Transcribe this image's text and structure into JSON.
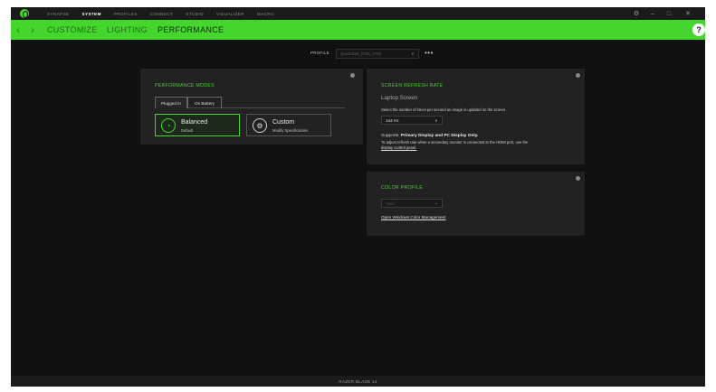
{
  "nav": {
    "items": [
      "SYNAPSE",
      "SYSTEM",
      "PROFILES",
      "CONNECT",
      "STUDIO",
      "VISUALIZER",
      "MACRO"
    ],
    "active": "SYSTEM"
  },
  "window_controls": {
    "settings": "⚙",
    "minimize": "–",
    "maximize": "□",
    "close": "✕"
  },
  "subnav": {
    "back": "‹",
    "forward": "›",
    "customize": "CUSTOMIZE",
    "lighting": "LIGHTING",
    "performance": "PERFORMANCE",
    "help": "?"
  },
  "profile": {
    "label": "PROFILE",
    "value": "QuickStart_0705_1708",
    "more": "•••"
  },
  "performance_modes": {
    "title": "PERFORMANCE MODES",
    "tabs": [
      "Plugged In",
      "On Battery"
    ],
    "active_tab": "Plugged In",
    "modes": [
      {
        "name": "Balanced",
        "sub": "Default",
        "selected": true
      },
      {
        "name": "Custom",
        "sub": "Modify Specifications",
        "selected": false
      }
    ]
  },
  "refresh_rate": {
    "title": "SCREEN REFRESH RATE",
    "subtitle": "Laptop Screen",
    "description": "Select the number of times per second an image is updated on the screen.",
    "value": "144 Hz",
    "supports_label": "Supports:",
    "supports_value": "Primary Display and PC Display Only.",
    "note": "To adjust refresh rate when a secondary monitor is connected to the HDMI port, use the",
    "note_link": "display control panel."
  },
  "color_profile": {
    "title": "COLOR PROFILE",
    "value": "Vivid",
    "link": "Open Windows Color Management"
  },
  "footer": {
    "device": "RAZER BLADE 14"
  },
  "colors": {
    "accent": "#44d62c",
    "background": "#111111",
    "panel": "#222222"
  }
}
